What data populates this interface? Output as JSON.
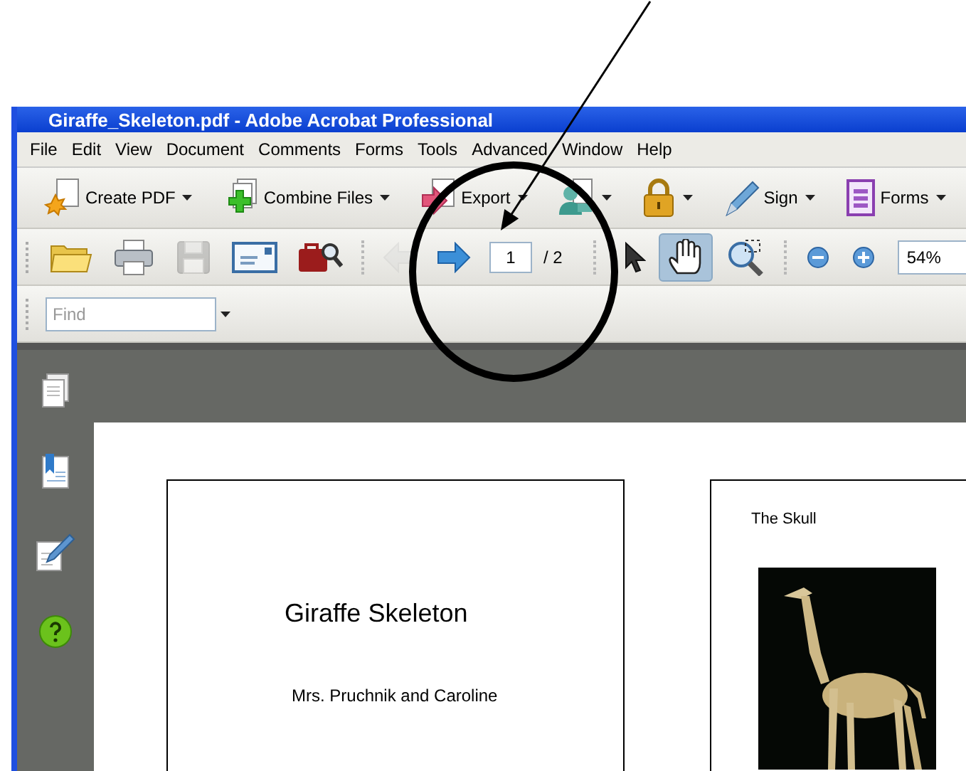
{
  "window": {
    "title": "Giraffe_Skeleton.pdf - Adobe Acrobat Professional"
  },
  "menu": [
    "File",
    "Edit",
    "View",
    "Document",
    "Comments",
    "Forms",
    "Tools",
    "Advanced",
    "Window",
    "Help"
  ],
  "task_buttons": [
    {
      "kind": "create_pdf",
      "label": "Create PDF"
    },
    {
      "kind": "combine",
      "label": "Combine Files"
    },
    {
      "kind": "export",
      "label": "Export"
    },
    {
      "kind": "review"
    },
    {
      "kind": "secure"
    },
    {
      "kind": "sign",
      "label": "Sign"
    },
    {
      "kind": "forms",
      "label": "Forms"
    }
  ],
  "file_tools": [
    {
      "kind": "open",
      "disabled": false
    },
    {
      "kind": "print",
      "disabled": false
    },
    {
      "kind": "save",
      "disabled": true
    },
    {
      "kind": "email",
      "disabled": false
    },
    {
      "kind": "bridge",
      "disabled": false
    }
  ],
  "page_nav": {
    "previous_disabled": true,
    "next_disabled": false,
    "page": "1",
    "count": "/ 2"
  },
  "view_tools": [
    {
      "kind": "select",
      "selected": false
    },
    {
      "kind": "hand",
      "selected": true
    },
    {
      "kind": "marquee_zoom",
      "selected": false
    }
  ],
  "zoom": {
    "value": "54%"
  },
  "find": {
    "placeholder": "Find"
  },
  "nav_panel": [
    {
      "kind": "pages"
    },
    {
      "kind": "bookmarks"
    },
    {
      "kind": "signatures"
    },
    {
      "kind": "help"
    }
  ],
  "pages": [
    {
      "title": "Giraffe Skeleton",
      "subtitle": "Mrs. Pruchnik and Caroline"
    },
    {
      "heading": "The Skull",
      "kind": "picture"
    }
  ]
}
